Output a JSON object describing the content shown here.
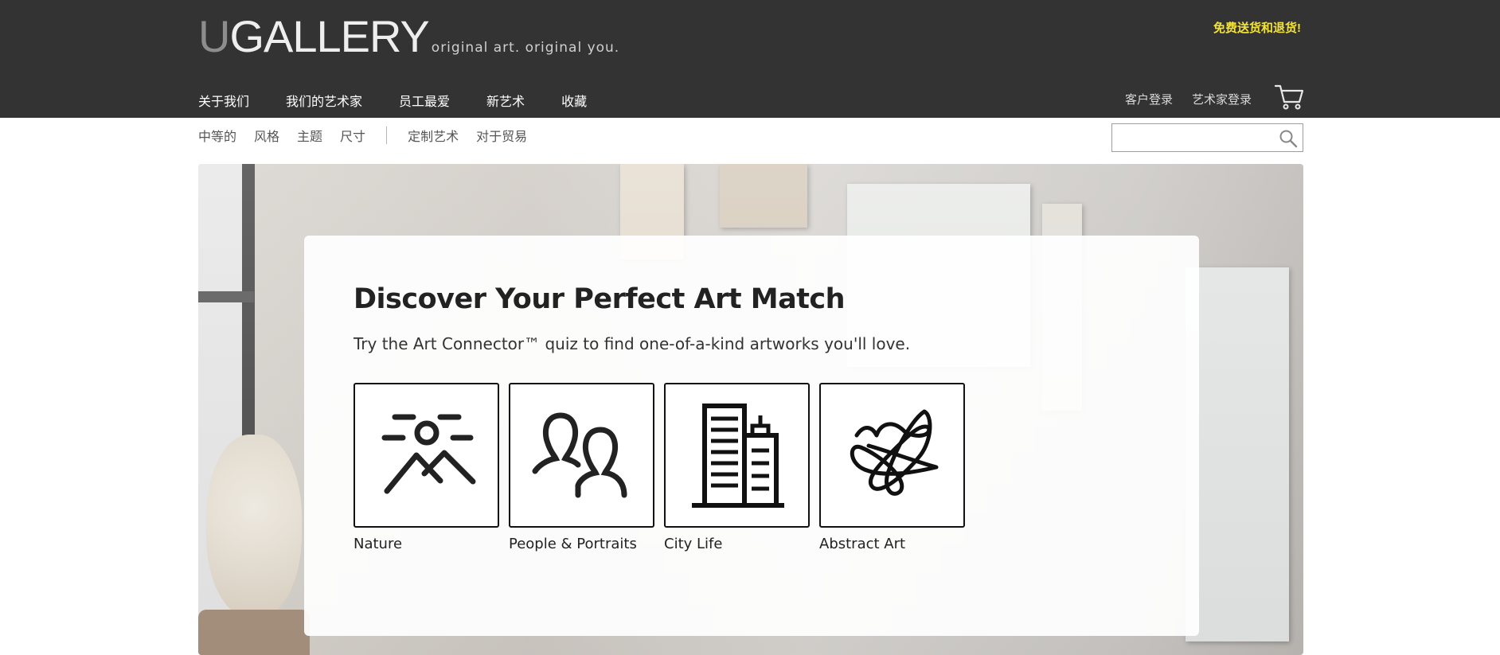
{
  "header": {
    "logo_main": "UGALLERY",
    "logo_u": "U",
    "logo_rest": "GALLERY",
    "logo_tagline": "original art. original you.",
    "promo": "免费送货和退货!",
    "main_nav": [
      "关于我们",
      "我们的艺术家",
      "员工最爱",
      "新艺术",
      "收藏"
    ],
    "account_nav": [
      "客户登录",
      "艺术家登录"
    ]
  },
  "sub_nav": {
    "filters": [
      "中等的",
      "风格",
      "主题",
      "尺寸"
    ],
    "links": [
      "定制艺术",
      "对于贸易"
    ]
  },
  "search": {
    "value": "",
    "placeholder": ""
  },
  "quiz": {
    "title": "Discover Your Perfect Art Match",
    "subtitle": "Try the Art Connector™ quiz to find one-of-a-kind artworks you'll love.",
    "options": [
      {
        "label": "Nature",
        "icon": "mountain-sun-icon"
      },
      {
        "label": "People & Portraits",
        "icon": "people-icon"
      },
      {
        "label": "City Life",
        "icon": "buildings-icon"
      },
      {
        "label": "Abstract Art",
        "icon": "scribble-icon"
      }
    ]
  },
  "colors": {
    "header_bg": "#333333",
    "promo": "#f2e23c",
    "separator": "#e0c020"
  }
}
